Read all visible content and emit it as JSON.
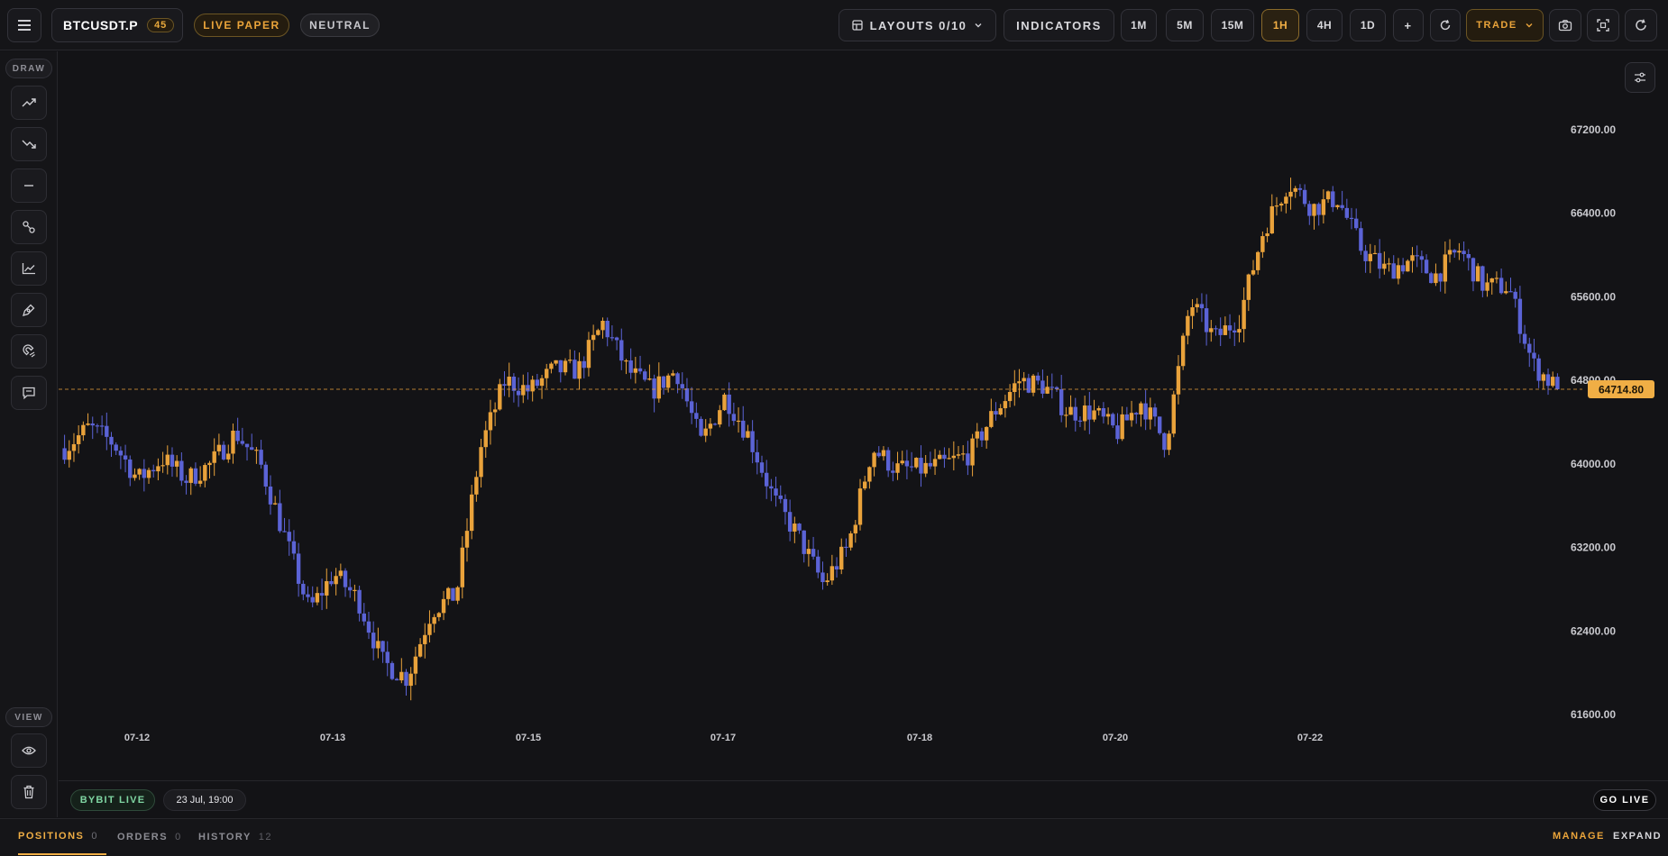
{
  "header": {
    "symbol": "BTCUSDT.P",
    "symbol_count": "45",
    "mode_badge": "LIVE PAPER",
    "bias_badge": "NEUTRAL",
    "layouts_label": "LAYOUTS 0/10",
    "indicators_label": "INDICATORS",
    "timeframes": [
      "1M",
      "5M",
      "15M",
      "1H",
      "4H",
      "1D"
    ],
    "active_timeframe": "1H",
    "add_label": "+",
    "trade_label": "TRADE"
  },
  "sidebar": {
    "draw_label": "DRAW",
    "view_label": "VIEW",
    "tools": [
      "trend-up-icon",
      "trend-down-icon",
      "horizontal-line-icon",
      "link-nodes-icon",
      "line-chart-icon",
      "pen-tool-icon",
      "magnet-icon",
      "comment-icon"
    ]
  },
  "status": {
    "source": "BYBIT LIVE",
    "timestamp": "23 Jul, 19:00",
    "go_live": "GO LIVE"
  },
  "bottom_tabs": [
    {
      "label": "POSITIONS",
      "count": "0"
    },
    {
      "label": "ORDERS",
      "count": "0"
    },
    {
      "label": "HISTORY",
      "count": "12"
    }
  ],
  "bottom_actions": {
    "manage": "MANAGE",
    "expand": "EXPAND"
  },
  "colors": {
    "up": "#e9a23b",
    "down": "#5b63d6",
    "accent": "#f0ae45",
    "background": "#131316"
  },
  "chart_data": {
    "type": "candlestick",
    "instrument": "BTCUSDT.P",
    "interval": "1H",
    "current_price": "64714.80",
    "price_axis_ticks": [
      "67200.00",
      "66400.00",
      "65600.00",
      "64800.00",
      "64000.00",
      "63200.00",
      "62400.00",
      "61600.00"
    ],
    "date_axis_ticks": [
      "07-12",
      "07-13",
      "07-15",
      "07-17",
      "07-18",
      "07-20",
      "07-22"
    ],
    "ylim": [
      61000,
      67600
    ],
    "anchors": [
      64150,
      64350,
      64200,
      63850,
      64050,
      63850,
      64000,
      64300,
      64000,
      63300,
      62600,
      62950,
      62700,
      62100,
      61950,
      62600,
      62750,
      64150,
      64800,
      64700,
      64900,
      64900,
      65350,
      64900,
      64700,
      64900,
      64200,
      64650,
      64250,
      63650,
      63300,
      62850,
      63200,
      64150,
      63950,
      63950,
      64000,
      64100,
      64500,
      64800,
      64750,
      64500,
      64500,
      64300,
      64600,
      64200,
      65550,
      65200,
      65400,
      66250,
      66700,
      66450,
      66550,
      66050,
      65850,
      65950,
      65800,
      66050,
      65700,
      65700,
      64950,
      64714.8
    ]
  }
}
